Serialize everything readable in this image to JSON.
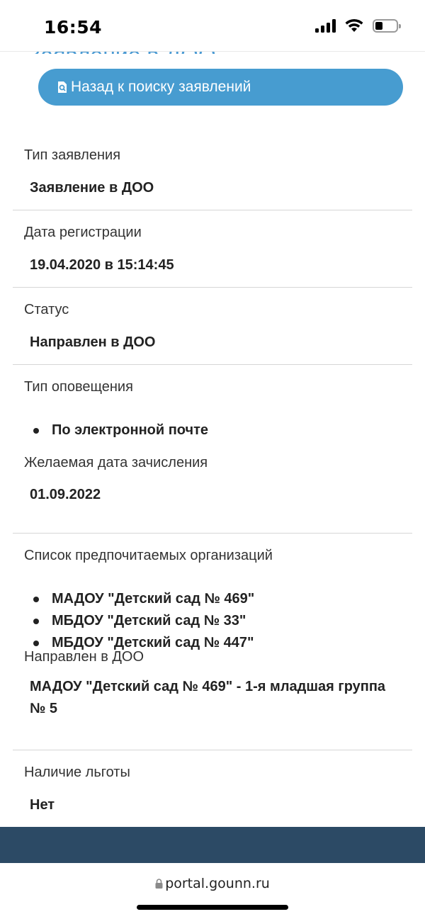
{
  "status_bar": {
    "time": "16:54",
    "icons": [
      "signal-icon",
      "wifi-icon",
      "battery-icon"
    ],
    "battery_level": 0.35
  },
  "heading_partial": "Заявление в ДОО",
  "back_button": {
    "label": "Назад к поиску заявлений",
    "icon": "search-document-icon"
  },
  "fields": {
    "type": {
      "label": "Тип заявления",
      "value": "Заявление в ДОО"
    },
    "reg_date": {
      "label": "Дата регистрации",
      "value": "19.04.2020 в 15:14:45"
    },
    "status": {
      "label": "Статус",
      "value": "Направлен в ДОО"
    },
    "notification": {
      "label": "Тип оповещения",
      "items": [
        "По электронной почте"
      ]
    },
    "desired_date": {
      "label": "Желаемая дата зачисления",
      "value": "01.09.2022"
    },
    "preferred_orgs": {
      "label": "Список предпочитаемых организаций",
      "items": [
        "МАДОУ \"Детский сад № 469\"",
        "МБДОУ \"Детский сад № 33\"",
        "МБДОУ \"Детский сад № 447\""
      ]
    },
    "assigned": {
      "label": "Направлен в ДОО",
      "value": "МАДОУ \"Детский сад № 469\" - 1-я младшая группа № 5"
    },
    "benefit": {
      "label": "Наличие льготы",
      "value": "Нет"
    }
  },
  "browser": {
    "url": "portal.gounn.ru"
  },
  "colors": {
    "accent": "#479cd0",
    "footer": "#2c4a65",
    "divider": "#d6d6d6"
  }
}
